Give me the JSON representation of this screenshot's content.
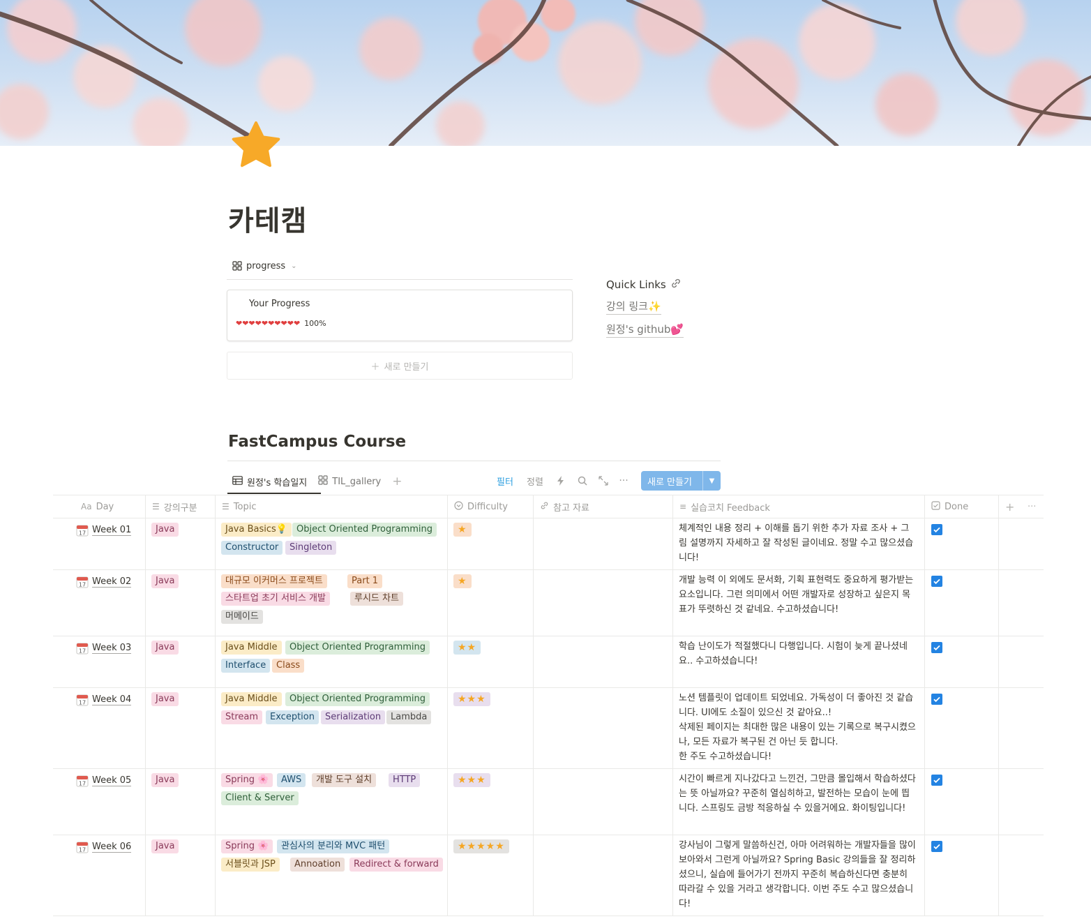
{
  "page": {
    "title": "카테캠",
    "icon": "star-icon"
  },
  "progress_view": {
    "view_name": "progress",
    "card_title": "Your Progress",
    "hearts": "❤❤❤❤❤❤❤❤❤❤",
    "percent": "100%",
    "progress_fraction": 1.0,
    "new_label": "새로 만들기"
  },
  "quick_links": {
    "title": "Quick Links",
    "links": [
      "강의 링크✨",
      "원정's github💕"
    ]
  },
  "course": {
    "title": "FastCampus Course",
    "tabs": [
      "원정's 학습일지",
      "TIL_gallery"
    ],
    "toolbar": {
      "filter": "필터",
      "sort": "정렬",
      "new_button": "새로 만들기"
    },
    "columns": [
      "Day",
      "강의구분",
      "Topic",
      "Difficulty",
      "참고 자료",
      "실습코치 Feedback",
      "Done"
    ],
    "rows": [
      {
        "day": "Week 01",
        "category": "Java",
        "topics": [
          {
            "label": "Java Basics💡",
            "color": "yellow"
          },
          {
            "label": "Object Oriented Programming",
            "color": "green"
          },
          {
            "label": "Constructor",
            "color": "blue"
          },
          {
            "label": "Singleton",
            "color": "purple"
          }
        ],
        "difficulty": "★",
        "difficulty_color": "orange",
        "feedback": "체계적인 내용 정리 + 이해를 돕기 위한 추가 자료 조사 + 그림 설명까지 자세하고 잘 작성된 글이네요. 정말 수고 많으셨습니다!",
        "done": true
      },
      {
        "day": "Week 02",
        "category": "Java",
        "topics": [
          {
            "label": "대규모 이커머스 프로젝트",
            "color": "orange"
          },
          {
            "label": "Part 1",
            "color": "orange"
          },
          {
            "label": "스타트업 초기 서비스 개발",
            "color": "pink"
          },
          {
            "label": "루시드 차트",
            "color": "brown"
          },
          {
            "label": "머메이드",
            "color": "gray"
          }
        ],
        "difficulty": "★",
        "difficulty_color": "orange",
        "feedback": "개발 능력 이 외에도 문서화, 기획 표현력도 중요하게 평가받는 요소입니다. 그런 의미에서 어떤 개발자로 성장하고 싶은지 목표가 뚜렷하신 것 같네요. 수고하셨습니다!",
        "done": true
      },
      {
        "day": "Week 03",
        "category": "Java",
        "topics": [
          {
            "label": "Java Middle",
            "color": "yellow"
          },
          {
            "label": "Object Oriented Programming",
            "color": "green"
          },
          {
            "label": "Interface",
            "color": "blue"
          },
          {
            "label": "Class",
            "color": "orange"
          }
        ],
        "difficulty": "★★",
        "difficulty_color": "blue",
        "feedback": "학습 난이도가 적절했다니 다행입니다. 시험이 늦게 끝나셨네요.. 수고하셨습니다!",
        "done": true
      },
      {
        "day": "Week 04",
        "category": "Java",
        "topics": [
          {
            "label": "Java Middle",
            "color": "yellow"
          },
          {
            "label": "Object Oriented Programming",
            "color": "green"
          },
          {
            "label": "Stream",
            "color": "pink"
          },
          {
            "label": "Exception",
            "color": "blue"
          },
          {
            "label": "Serialization",
            "color": "purple"
          },
          {
            "label": "Lambda",
            "color": "gray"
          }
        ],
        "difficulty": "★★★",
        "difficulty_color": "purple",
        "feedback_lines": [
          "노션 템플릿이 업데이트 되었네요. 가독성이 더 좋아진 것 같습니다. UI에도 소질이 있으신 것 같아요..!",
          "삭제된 페이지는 최대한 많은 내용이 있는 기록으로 복구시켰으나, 모든 자료가 복구된 건 아닌 듯 합니다.",
          "한 주도 수고하셨습니다!"
        ],
        "done": true
      },
      {
        "day": "Week 05",
        "category": "Java",
        "topics": [
          {
            "label": "Spring 🌸",
            "color": "pink"
          },
          {
            "label": "AWS",
            "color": "blue"
          },
          {
            "label": "개발 도구 설치",
            "color": "brown"
          },
          {
            "label": "HTTP",
            "color": "purple"
          },
          {
            "label": "Client & Server",
            "color": "green"
          }
        ],
        "difficulty": "★★★",
        "difficulty_color": "purple",
        "feedback": "시간이 빠르게 지나갔다고 느낀건, 그만큼 몰입해서 학습하셨다는 뜻 아닐까요? 꾸준히 열심히하고, 발전하는 모습이 눈에 띕니다. 스프링도 금방 적응하실 수 있을거에요. 화이팅입니다!",
        "done": true
      },
      {
        "day": "Week 06",
        "category": "Java",
        "topics": [
          {
            "label": "Spring 🌸",
            "color": "pink"
          },
          {
            "label": "관심사의 분리와 MVC 패턴",
            "color": "blue"
          },
          {
            "label": "서블릿과 JSP",
            "color": "yellow"
          },
          {
            "label": "Annoation",
            "color": "brown"
          },
          {
            "label": "Redirect & forward",
            "color": "pink"
          }
        ],
        "difficulty": "★★★★★",
        "difficulty_color": "gray",
        "feedback": "강사님이 그렇게 말씀하신건, 아마 어려워하는 개발자들을 많이 보아와서 그런게 아닐까요? Spring Basic 강의들을 잘 정리하셨으니, 실습에 들어가기 전까지 꾸준히 복습하신다면 충분히 따라갈 수 있을 거라고 생각합니다. 이번 주도 수고 많으셨습니다!",
        "done": true
      }
    ]
  },
  "colors": {
    "accent": "#2383e2",
    "new_button": "#7fb7ea",
    "filter": "#2ea0e0",
    "star": "#f5a623"
  }
}
